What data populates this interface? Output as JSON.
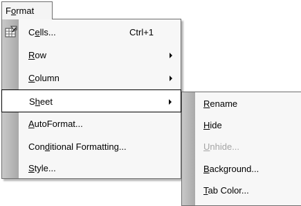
{
  "menubar": {
    "title_pre": "F",
    "title_u": "o",
    "title_post": "rmat"
  },
  "format_menu": {
    "items": [
      {
        "pre": "C",
        "u": "e",
        "post": "lls...",
        "shortcut": "Ctrl+1",
        "icon": "format-cells-icon"
      },
      {
        "pre": "",
        "u": "R",
        "post": "ow",
        "submenu": true
      },
      {
        "pre": "",
        "u": "C",
        "post": "olumn",
        "submenu": true
      },
      {
        "pre": "S",
        "u": "h",
        "post": "eet",
        "submenu": true,
        "selected": true
      },
      {
        "pre": "",
        "u": "A",
        "post": "utoFormat..."
      },
      {
        "pre": "Con",
        "u": "d",
        "post": "itional Formatting..."
      },
      {
        "pre": "",
        "u": "S",
        "post": "tyle..."
      }
    ]
  },
  "sheet_submenu": {
    "items": [
      {
        "pre": "",
        "u": "R",
        "post": "ename"
      },
      {
        "pre": "",
        "u": "H",
        "post": "ide"
      },
      {
        "pre": "",
        "u": "U",
        "post": "nhide...",
        "disabled": true
      },
      {
        "pre": "",
        "u": "B",
        "post": "ackground..."
      },
      {
        "pre": "",
        "u": "T",
        "post": "ab Color..."
      }
    ]
  },
  "colors": {
    "menu_bg": "#f7f7f7",
    "gutter": "#b5b5b5",
    "disabled_text": "#a4a4a4",
    "selected_border": "#000000"
  }
}
